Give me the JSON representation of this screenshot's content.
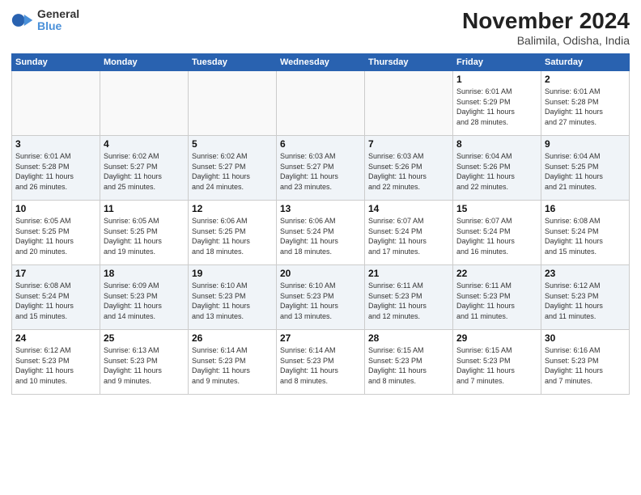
{
  "header": {
    "logo_line1": "General",
    "logo_line2": "Blue",
    "month": "November 2024",
    "location": "Balimila, Odisha, India"
  },
  "weekdays": [
    "Sunday",
    "Monday",
    "Tuesday",
    "Wednesday",
    "Thursday",
    "Friday",
    "Saturday"
  ],
  "weeks": [
    [
      {
        "day": "",
        "info": ""
      },
      {
        "day": "",
        "info": ""
      },
      {
        "day": "",
        "info": ""
      },
      {
        "day": "",
        "info": ""
      },
      {
        "day": "",
        "info": ""
      },
      {
        "day": "1",
        "info": "Sunrise: 6:01 AM\nSunset: 5:29 PM\nDaylight: 11 hours\nand 28 minutes."
      },
      {
        "day": "2",
        "info": "Sunrise: 6:01 AM\nSunset: 5:28 PM\nDaylight: 11 hours\nand 27 minutes."
      }
    ],
    [
      {
        "day": "3",
        "info": "Sunrise: 6:01 AM\nSunset: 5:28 PM\nDaylight: 11 hours\nand 26 minutes."
      },
      {
        "day": "4",
        "info": "Sunrise: 6:02 AM\nSunset: 5:27 PM\nDaylight: 11 hours\nand 25 minutes."
      },
      {
        "day": "5",
        "info": "Sunrise: 6:02 AM\nSunset: 5:27 PM\nDaylight: 11 hours\nand 24 minutes."
      },
      {
        "day": "6",
        "info": "Sunrise: 6:03 AM\nSunset: 5:27 PM\nDaylight: 11 hours\nand 23 minutes."
      },
      {
        "day": "7",
        "info": "Sunrise: 6:03 AM\nSunset: 5:26 PM\nDaylight: 11 hours\nand 22 minutes."
      },
      {
        "day": "8",
        "info": "Sunrise: 6:04 AM\nSunset: 5:26 PM\nDaylight: 11 hours\nand 22 minutes."
      },
      {
        "day": "9",
        "info": "Sunrise: 6:04 AM\nSunset: 5:25 PM\nDaylight: 11 hours\nand 21 minutes."
      }
    ],
    [
      {
        "day": "10",
        "info": "Sunrise: 6:05 AM\nSunset: 5:25 PM\nDaylight: 11 hours\nand 20 minutes."
      },
      {
        "day": "11",
        "info": "Sunrise: 6:05 AM\nSunset: 5:25 PM\nDaylight: 11 hours\nand 19 minutes."
      },
      {
        "day": "12",
        "info": "Sunrise: 6:06 AM\nSunset: 5:25 PM\nDaylight: 11 hours\nand 18 minutes."
      },
      {
        "day": "13",
        "info": "Sunrise: 6:06 AM\nSunset: 5:24 PM\nDaylight: 11 hours\nand 18 minutes."
      },
      {
        "day": "14",
        "info": "Sunrise: 6:07 AM\nSunset: 5:24 PM\nDaylight: 11 hours\nand 17 minutes."
      },
      {
        "day": "15",
        "info": "Sunrise: 6:07 AM\nSunset: 5:24 PM\nDaylight: 11 hours\nand 16 minutes."
      },
      {
        "day": "16",
        "info": "Sunrise: 6:08 AM\nSunset: 5:24 PM\nDaylight: 11 hours\nand 15 minutes."
      }
    ],
    [
      {
        "day": "17",
        "info": "Sunrise: 6:08 AM\nSunset: 5:24 PM\nDaylight: 11 hours\nand 15 minutes."
      },
      {
        "day": "18",
        "info": "Sunrise: 6:09 AM\nSunset: 5:23 PM\nDaylight: 11 hours\nand 14 minutes."
      },
      {
        "day": "19",
        "info": "Sunrise: 6:10 AM\nSunset: 5:23 PM\nDaylight: 11 hours\nand 13 minutes."
      },
      {
        "day": "20",
        "info": "Sunrise: 6:10 AM\nSunset: 5:23 PM\nDaylight: 11 hours\nand 13 minutes."
      },
      {
        "day": "21",
        "info": "Sunrise: 6:11 AM\nSunset: 5:23 PM\nDaylight: 11 hours\nand 12 minutes."
      },
      {
        "day": "22",
        "info": "Sunrise: 6:11 AM\nSunset: 5:23 PM\nDaylight: 11 hours\nand 11 minutes."
      },
      {
        "day": "23",
        "info": "Sunrise: 6:12 AM\nSunset: 5:23 PM\nDaylight: 11 hours\nand 11 minutes."
      }
    ],
    [
      {
        "day": "24",
        "info": "Sunrise: 6:12 AM\nSunset: 5:23 PM\nDaylight: 11 hours\nand 10 minutes."
      },
      {
        "day": "25",
        "info": "Sunrise: 6:13 AM\nSunset: 5:23 PM\nDaylight: 11 hours\nand 9 minutes."
      },
      {
        "day": "26",
        "info": "Sunrise: 6:14 AM\nSunset: 5:23 PM\nDaylight: 11 hours\nand 9 minutes."
      },
      {
        "day": "27",
        "info": "Sunrise: 6:14 AM\nSunset: 5:23 PM\nDaylight: 11 hours\nand 8 minutes."
      },
      {
        "day": "28",
        "info": "Sunrise: 6:15 AM\nSunset: 5:23 PM\nDaylight: 11 hours\nand 8 minutes."
      },
      {
        "day": "29",
        "info": "Sunrise: 6:15 AM\nSunset: 5:23 PM\nDaylight: 11 hours\nand 7 minutes."
      },
      {
        "day": "30",
        "info": "Sunrise: 6:16 AM\nSunset: 5:23 PM\nDaylight: 11 hours\nand 7 minutes."
      }
    ]
  ]
}
